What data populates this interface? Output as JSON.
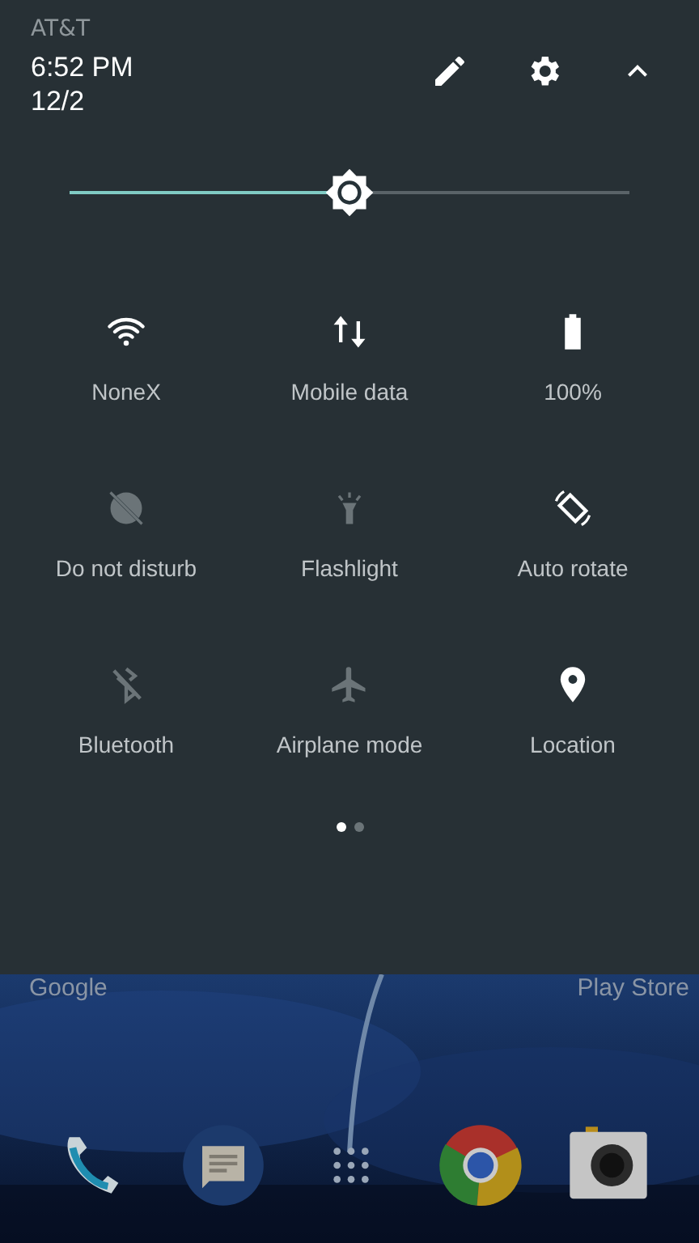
{
  "status": {
    "carrier": "AT&T",
    "time": "6:52 PM",
    "date": "12/2"
  },
  "header_actions": [
    {
      "kind": "edit"
    },
    {
      "kind": "settings"
    },
    {
      "kind": "collapse"
    }
  ],
  "brightness": {
    "level": 0.5
  },
  "tiles": [
    {
      "kind": "wifi",
      "label": "NoneX",
      "on": true
    },
    {
      "kind": "data",
      "label": "Mobile data",
      "on": true
    },
    {
      "kind": "battery",
      "label": "100%",
      "on": true
    },
    {
      "kind": "dnd",
      "label": "Do not disturb",
      "on": false
    },
    {
      "kind": "flashlight",
      "label": "Flashlight",
      "on": false
    },
    {
      "kind": "rotate",
      "label": "Auto rotate",
      "on": true
    },
    {
      "kind": "bluetooth",
      "label": "Bluetooth",
      "on": false
    },
    {
      "kind": "airplane",
      "label": "Airplane mode",
      "on": false
    },
    {
      "kind": "location",
      "label": "Location",
      "on": true
    }
  ],
  "pages": [
    {
      "selected": true
    },
    {
      "selected": false
    }
  ],
  "home": {
    "shortcuts": [
      "Google",
      "Play Store"
    ],
    "dock": [
      {
        "kind": "phone"
      },
      {
        "kind": "messages"
      },
      {
        "kind": "apps"
      },
      {
        "kind": "browser"
      },
      {
        "kind": "camera"
      }
    ]
  }
}
